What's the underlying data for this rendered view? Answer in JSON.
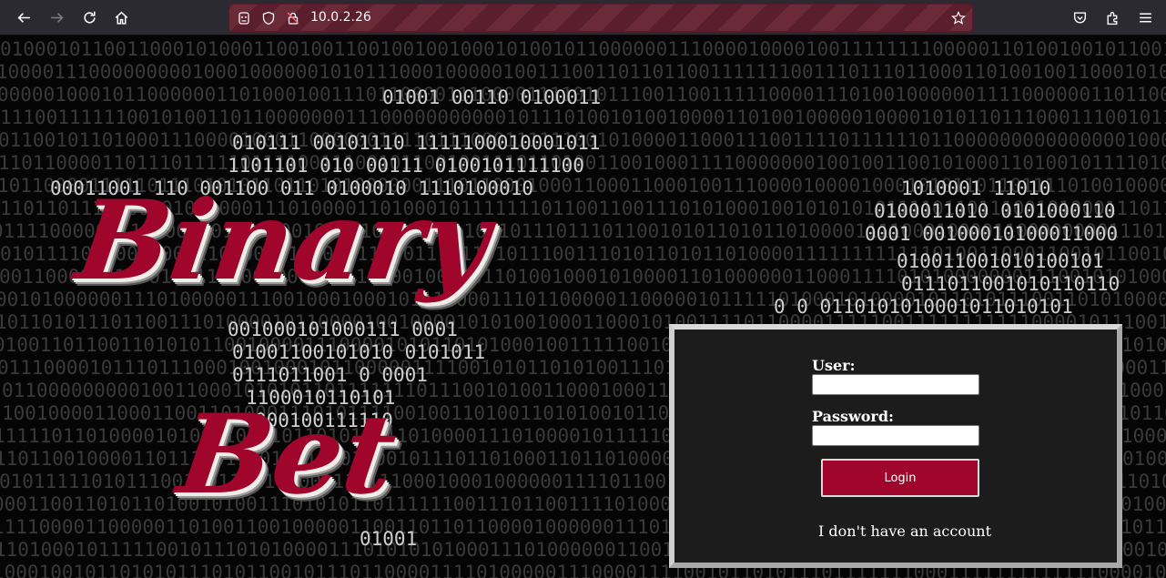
{
  "browser": {
    "url": "10.0.2.26",
    "icons": [
      "back-icon",
      "forward-icon",
      "reload-icon",
      "home-icon",
      "extension-icon",
      "shield-icon",
      "lock-icon",
      "bookmark-star-icon",
      "pocket-icon",
      "extensions-icon",
      "menu-icon"
    ]
  },
  "login": {
    "user_label": "User:",
    "password_label": "Password:",
    "login_button": "Login",
    "no_account_link": "I don't have an account"
  },
  "logo": {
    "line1": "Binary",
    "line2": "Bet",
    "color": "#a0052c"
  },
  "colors": {
    "accent": "#a0052c",
    "toolbar": "#2b2a33",
    "panel": "#1c1c1c"
  }
}
